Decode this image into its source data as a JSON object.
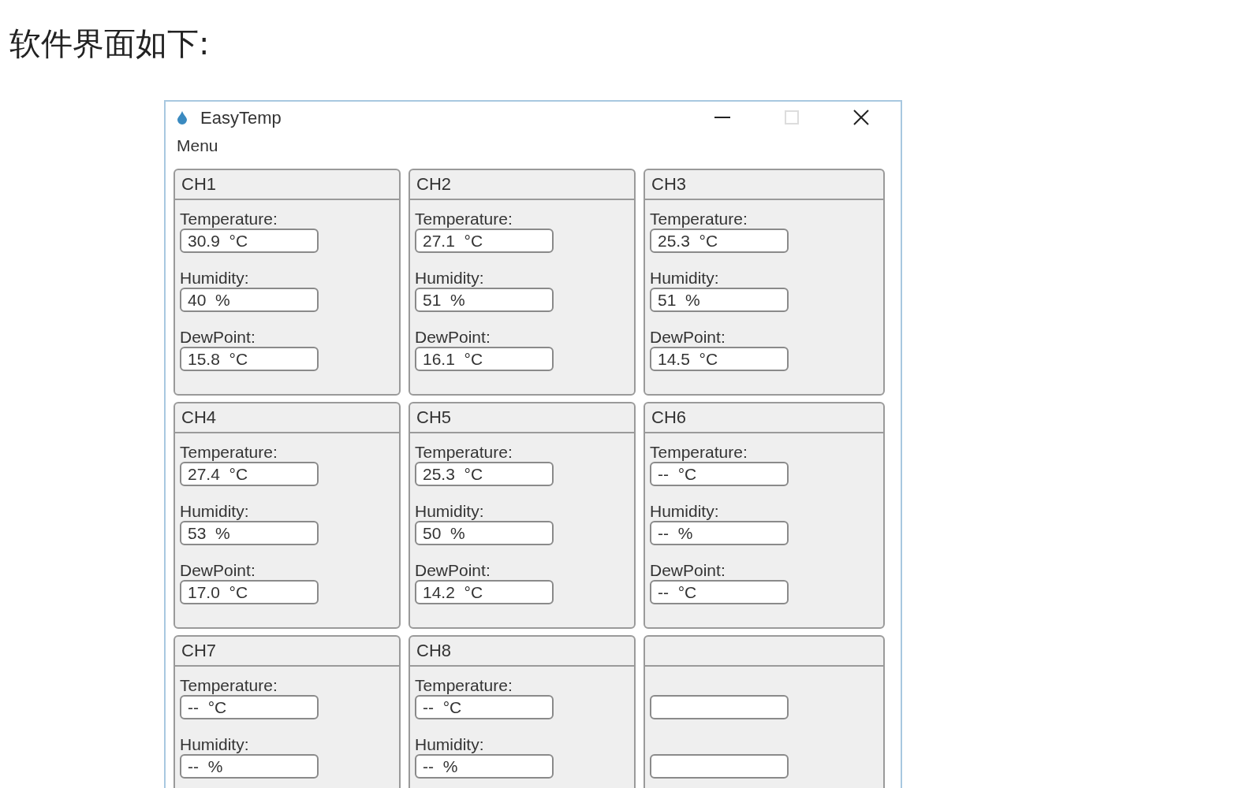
{
  "heading": "软件界面如下:",
  "window": {
    "title": "EasyTemp",
    "maximize_disabled": true
  },
  "menu": [
    "Menu"
  ],
  "channels": [
    {
      "kind": "channel",
      "title": "CH1",
      "fields": [
        {
          "label": "Temperature:",
          "value": "30.9  °C"
        },
        {
          "label": "Humidity:",
          "value": "40  %"
        },
        {
          "label": "DewPoint:",
          "value": "15.8  °C"
        }
      ]
    },
    {
      "kind": "channel",
      "title": "CH2",
      "fields": [
        {
          "label": "Temperature:",
          "value": "27.1  °C"
        },
        {
          "label": "Humidity:",
          "value": "51  %"
        },
        {
          "label": "DewPoint:",
          "value": "16.1  °C"
        }
      ]
    },
    {
      "kind": "channel",
      "title": "CH3",
      "fields": [
        {
          "label": "Temperature:",
          "value": "25.3  °C"
        },
        {
          "label": "Humidity:",
          "value": "51  %"
        },
        {
          "label": "DewPoint:",
          "value": "14.5  °C"
        }
      ]
    },
    {
      "kind": "channel",
      "title": "CH4",
      "fields": [
        {
          "label": "Temperature:",
          "value": "27.4  °C"
        },
        {
          "label": "Humidity:",
          "value": "53  %"
        },
        {
          "label": "DewPoint:",
          "value": "17.0  °C"
        }
      ]
    },
    {
      "kind": "channel",
      "title": "CH5",
      "fields": [
        {
          "label": "Temperature:",
          "value": "25.3  °C"
        },
        {
          "label": "Humidity:",
          "value": "50  %"
        },
        {
          "label": "DewPoint:",
          "value": "14.2  °C"
        }
      ]
    },
    {
      "kind": "channel",
      "title": "CH6",
      "fields": [
        {
          "label": "Temperature:",
          "value": "--  °C"
        },
        {
          "label": "Humidity:",
          "value": "--  %"
        },
        {
          "label": "DewPoint:",
          "value": "--  °C"
        }
      ]
    },
    {
      "kind": "channel",
      "title": "CH7",
      "fields": [
        {
          "label": "Temperature:",
          "value": "--  °C"
        },
        {
          "label": "Humidity:",
          "value": "--  %"
        }
      ]
    },
    {
      "kind": "channel",
      "title": "CH8",
      "fields": [
        {
          "label": "Temperature:",
          "value": "--  °C"
        },
        {
          "label": "Humidity:",
          "value": "--  %"
        }
      ]
    },
    {
      "kind": "blank",
      "fields": [
        {
          "kind": "empty"
        },
        {
          "kind": "empty"
        }
      ]
    }
  ]
}
